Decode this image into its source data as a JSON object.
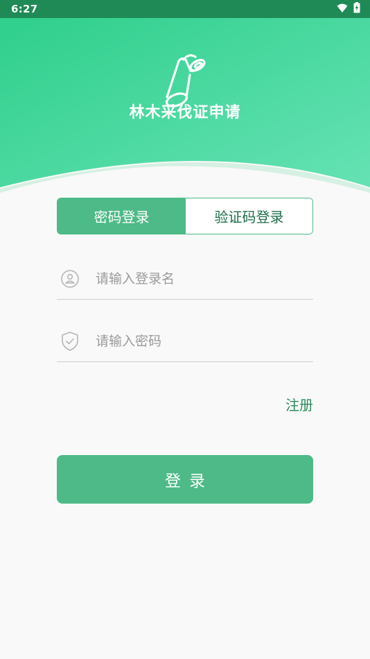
{
  "status_bar": {
    "time": "6:27",
    "icons": [
      "wifi-icon",
      "battery-charging-icon"
    ]
  },
  "header": {
    "logo_icon": "log-wood-icon",
    "title": "林木采伐证申请",
    "colors": {
      "gradient_start": "#2fcf8c",
      "gradient_end": "#62e0b0"
    }
  },
  "login_tabs": {
    "password_tab": "密码登录",
    "code_tab": "验证码登录",
    "active": "password_tab"
  },
  "form": {
    "username": {
      "value": "",
      "placeholder": "请输入登录名",
      "icon": "user-circle-icon"
    },
    "password": {
      "value": "",
      "placeholder": "请输入密码",
      "icon": "shield-check-icon"
    }
  },
  "register_link": "注册",
  "login_button": "登录",
  "colors": {
    "accent": "#4dba87",
    "link": "#2b8a5c",
    "status_bar": "#1f8a55"
  }
}
